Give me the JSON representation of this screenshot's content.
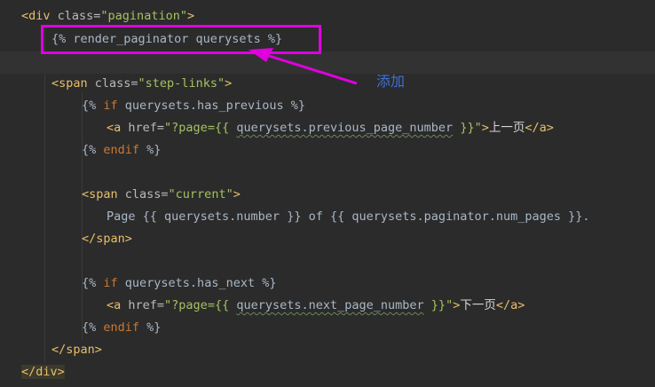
{
  "code": {
    "l1": {
      "open": "<div",
      "attr": " class=",
      "val": "\"pagination\"",
      "close": ">"
    },
    "l2": {
      "text": "{% render_paginator querysets %}"
    },
    "l4": {
      "open": "<span",
      "attr": " class=",
      "val": "\"step-links\"",
      "close": ">"
    },
    "l5": {
      "pre": "{% ",
      "kw": "if",
      "post": " querysets.has_previous %}"
    },
    "l6": {
      "open": "<a",
      "attr": " href=",
      "val1": "\"?page=",
      "tpl_open": "{{ ",
      "expr": "querysets.previous_page_number",
      "tpl_close": " }}",
      "val2": "\"",
      "close": ">",
      "text": "上一页",
      "end": "</a>"
    },
    "l7": {
      "pre": "{% ",
      "kw": "endif",
      "post": " %}"
    },
    "l9": {
      "open": "<span",
      "attr": " class=",
      "val": "\"current\"",
      "close": ">"
    },
    "l10": {
      "text": "Page {{ querysets.number }} of {{ querysets.paginator.num_pages }}."
    },
    "l11": {
      "end": "</span>"
    },
    "l13": {
      "pre": "{% ",
      "kw": "if",
      "post": " querysets.has_next %}"
    },
    "l14": {
      "open": "<a",
      "attr": " href=",
      "val1": "\"?page=",
      "tpl_open": "{{ ",
      "expr": "querysets.next_page_number",
      "tpl_close": " }}",
      "val2": "\"",
      "close": ">",
      "text": "下一页",
      "end": "</a>"
    },
    "l15": {
      "pre": "{% ",
      "kw": "endif",
      "post": " %}"
    },
    "l16": {
      "end": "</span>"
    },
    "l17": {
      "end": "</div>"
    }
  },
  "annotation": {
    "label": "添加",
    "box_color": "#e000e0",
    "label_color": "#3f6fd8"
  },
  "colors": {
    "background": "#2b2b2b",
    "tag": "#e8bf6a",
    "string": "#a5c261",
    "keyword": "#cc7832",
    "text": "#a9b7c6"
  }
}
